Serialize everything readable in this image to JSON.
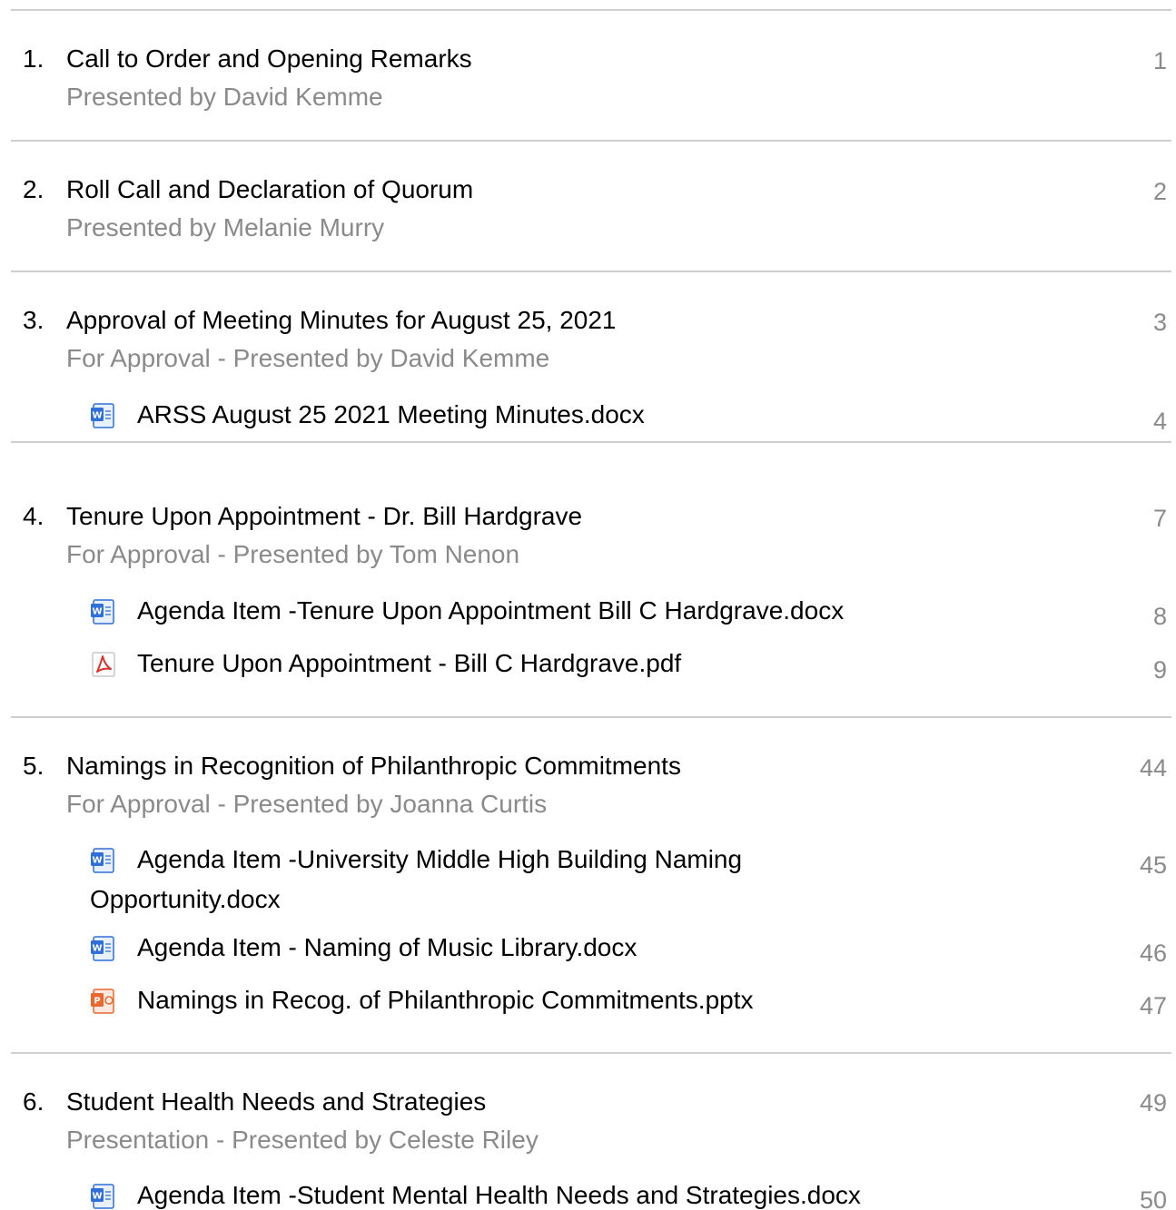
{
  "items": [
    {
      "number": "1.",
      "title": "Call to Order and Opening Remarks",
      "subtitle": "Presented by David Kemme",
      "page": "1",
      "attachments": []
    },
    {
      "number": "2.",
      "title": "Roll Call and Declaration of Quorum",
      "subtitle": "Presented by Melanie Murry",
      "page": "2",
      "attachments": []
    },
    {
      "number": "3.",
      "title": "Approval of Meeting Minutes for August 25, 2021",
      "subtitle": "For Approval - Presented by David Kemme",
      "page": "3",
      "attachments": [
        {
          "name": "ARSS August 25 2021 Meeting Minutes.docx",
          "page": "4",
          "icon": "word-doc-icon"
        }
      ]
    },
    {
      "number": "4.",
      "title": "Tenure Upon Appointment - Dr. Bill Hardgrave",
      "subtitle": "For Approval - Presented by Tom Nenon",
      "page": "7",
      "attachments": [
        {
          "name": "Agenda Item -Tenure Upon Appointment Bill C Hardgrave.docx",
          "page": "8",
          "icon": "word-doc-icon"
        },
        {
          "name": "Tenure Upon Appointment - Bill C Hardgrave.pdf",
          "page": "9",
          "icon": "pdf-icon"
        }
      ]
    },
    {
      "number": "5.",
      "title": "Namings in Recognition of Philanthropic Commitments",
      "subtitle": "For Approval - Presented by Joanna Curtis",
      "page": "44",
      "attachments": [
        {
          "name": "Agenda Item -University Middle  High Building Naming Opportunity.docx",
          "page": "45",
          "icon": "word-doc-icon"
        },
        {
          "name": "Agenda Item - Naming of Music Library.docx",
          "page": "46",
          "icon": "word-doc-icon"
        },
        {
          "name": "Namings in Recog. of Philanthropic Commitments.pptx",
          "page": "47",
          "icon": "powerpoint-icon"
        }
      ]
    },
    {
      "number": "6.",
      "title": "Student Health Needs and Strategies",
      "subtitle": "Presentation - Presented by Celeste Riley",
      "page": "49",
      "attachments": [
        {
          "name": "Agenda Item -Student Mental Health Needs and Strategies.docx",
          "page": "50",
          "icon": "word-doc-icon"
        }
      ]
    }
  ],
  "colors": {
    "divider": "#cfcfcf",
    "muted_text": "#8a8a8a",
    "word_blue": "#2f6fd6",
    "pdf_red": "#d9342b",
    "ppt_orange": "#e8692f"
  }
}
